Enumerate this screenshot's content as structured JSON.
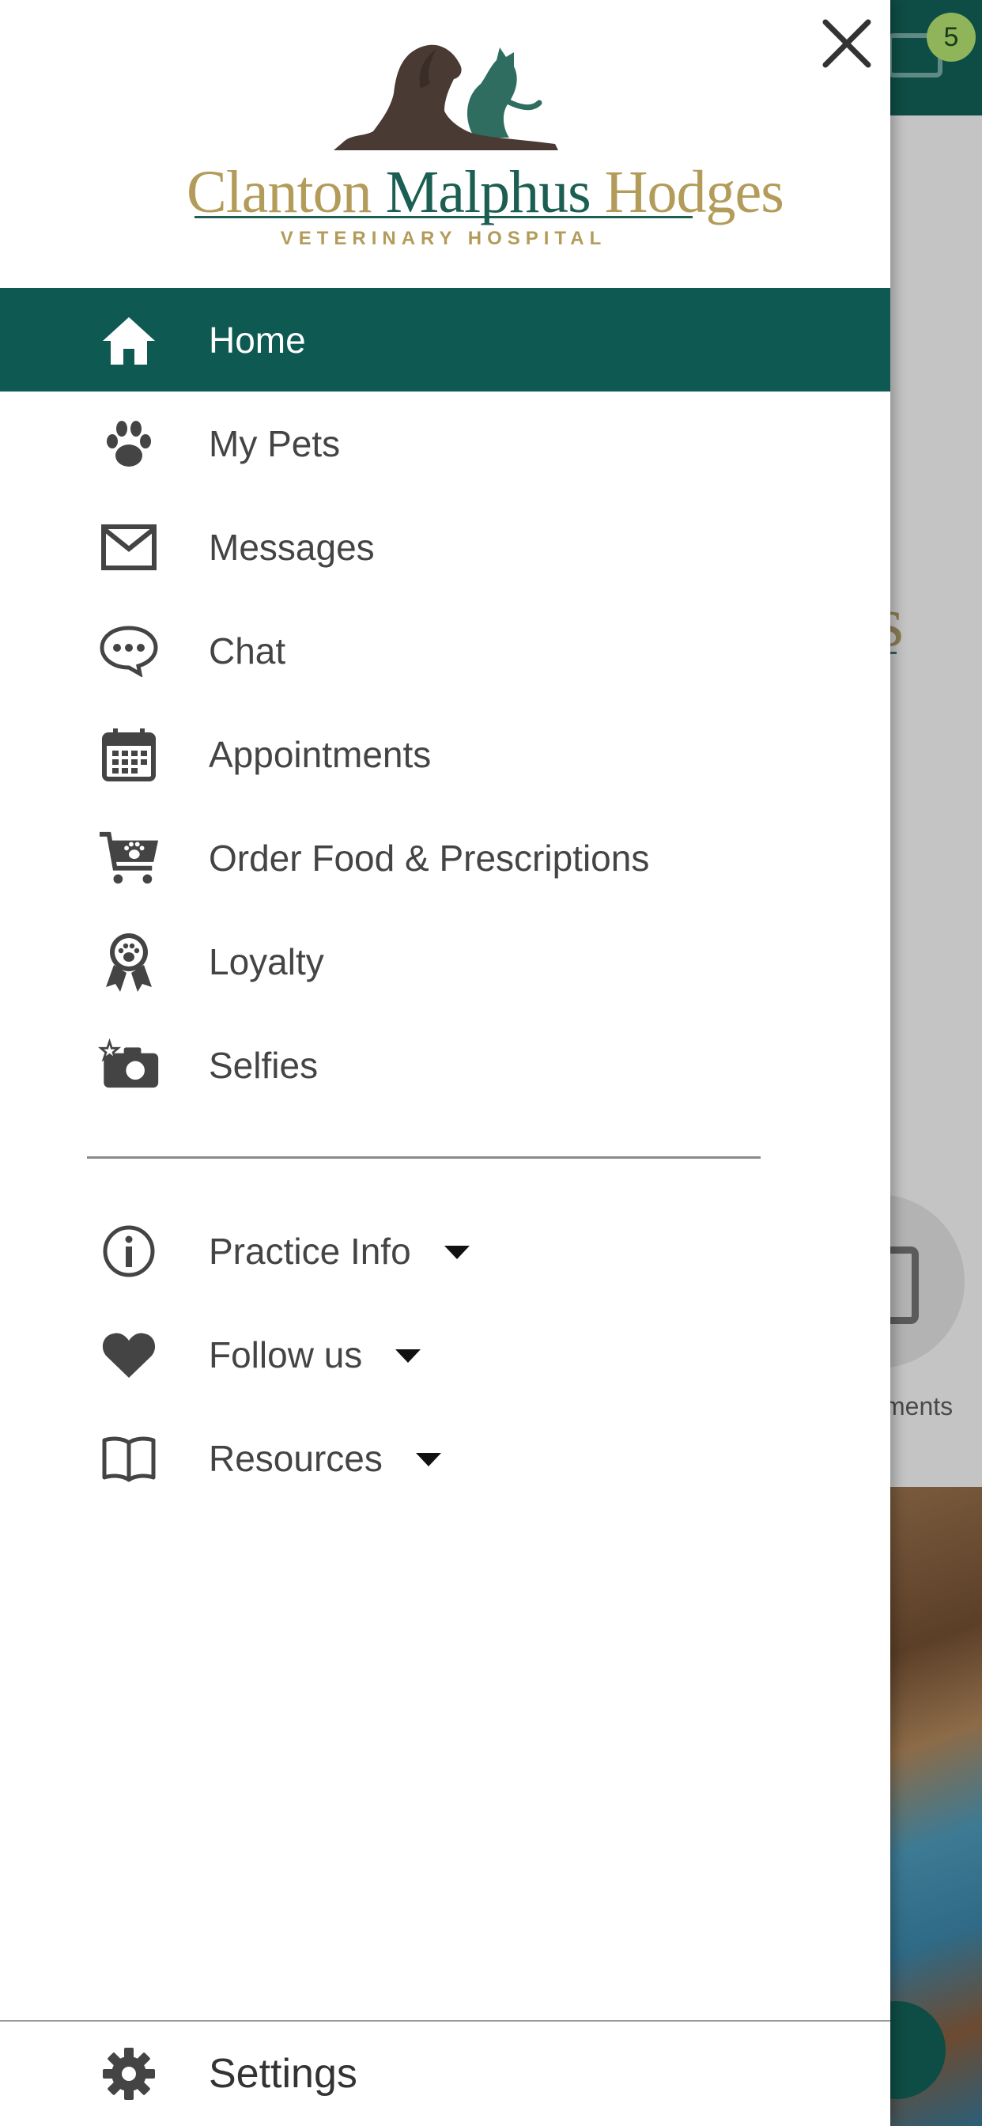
{
  "background": {
    "unread_count": "5",
    "logo_fragment": "s",
    "appointments_fragment": "ments"
  },
  "logo": {
    "name_part1": "Clanton",
    "name_part2": "Malphus",
    "name_part3": "Hodges",
    "subtitle": "VETERINARY HOSPITAL"
  },
  "menu": {
    "items": [
      {
        "label": "Home",
        "icon": "home-icon",
        "active": true
      },
      {
        "label": "My Pets",
        "icon": "paw-icon"
      },
      {
        "label": "Messages",
        "icon": "envelope-icon"
      },
      {
        "label": "Chat",
        "icon": "chat-bubble-icon"
      },
      {
        "label": "Appointments",
        "icon": "calendar-icon"
      },
      {
        "label": "Order Food & Prescriptions",
        "icon": "cart-icon"
      },
      {
        "label": "Loyalty",
        "icon": "award-ribbon-icon"
      },
      {
        "label": "Selfies",
        "icon": "camera-icon"
      }
    ],
    "expandable": [
      {
        "label": "Practice Info",
        "icon": "info-icon"
      },
      {
        "label": "Follow us",
        "icon": "heart-icon"
      },
      {
        "label": "Resources",
        "icon": "book-icon"
      }
    ],
    "settings_label": "Settings"
  },
  "colors": {
    "brand_green": "#0e5a52",
    "brand_gold": "#b39c5a",
    "text": "#444444"
  }
}
